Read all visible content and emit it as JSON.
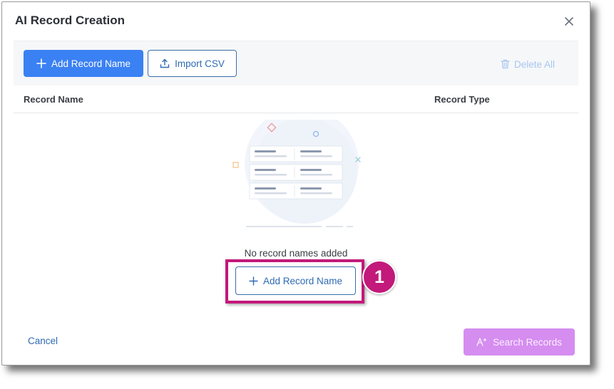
{
  "dialog": {
    "title": "AI Record Creation"
  },
  "toolbar": {
    "add_record_label": "Add Record Name",
    "import_csv_label": "Import CSV",
    "delete_all_label": "Delete All"
  },
  "table": {
    "columns": [
      "Record Name",
      "Record Type"
    ]
  },
  "empty_state": {
    "message": "No record names added",
    "add_button_label": "Add Record Name"
  },
  "annotation": {
    "step_number": "1"
  },
  "footer": {
    "cancel_label": "Cancel",
    "search_label": "Search Records"
  },
  "colors": {
    "primary": "#3a81f3",
    "highlight": "#c2197a",
    "search_button": "#d58df0"
  },
  "icons": {
    "close": "close-icon",
    "add": "plus-icon",
    "upload": "upload-icon",
    "trash": "trash-icon",
    "ai": "ai-sparkle-icon"
  }
}
